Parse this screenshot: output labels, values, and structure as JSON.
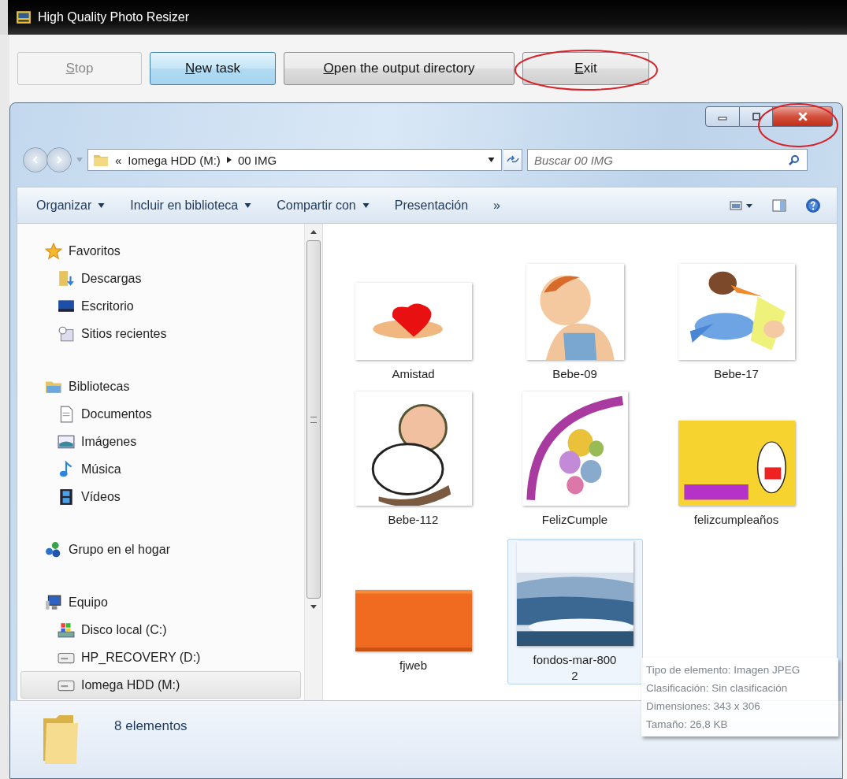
{
  "app_window": {
    "title": "High Quality Photo Resizer"
  },
  "app_buttons": [
    {
      "access": "S",
      "label": "top",
      "disabled": true,
      "default": false
    },
    {
      "access": "N",
      "label": "ew task",
      "disabled": false,
      "default": true
    },
    {
      "access": "O",
      "label": "pen the output directory",
      "disabled": false,
      "default": false
    },
    {
      "access": "E",
      "label": "xit",
      "disabled": false,
      "default": false
    }
  ],
  "explorer": {
    "address": {
      "overflow": "«",
      "crumbs": [
        "Iomega HDD (M:)",
        "00 IMG"
      ]
    },
    "search": {
      "placeholder": "Buscar 00 IMG"
    },
    "commands": [
      {
        "label": "Organizar",
        "dropdown": true
      },
      {
        "label": "Incluir en biblioteca",
        "dropdown": true
      },
      {
        "label": "Compartir con",
        "dropdown": true
      },
      {
        "label": "Presentación",
        "dropdown": false
      },
      {
        "label": "»",
        "dropdown": false
      }
    ],
    "nav": [
      {
        "label": "Favoritos",
        "selected": false,
        "children": [
          {
            "label": "Descargas",
            "selected": false
          },
          {
            "label": "Escritorio",
            "selected": false
          },
          {
            "label": "Sitios recientes",
            "selected": false
          }
        ]
      },
      {
        "label": "Bibliotecas",
        "selected": false,
        "children": [
          {
            "label": "Documentos",
            "selected": false
          },
          {
            "label": "Imágenes",
            "selected": false
          },
          {
            "label": "Música",
            "selected": false
          },
          {
            "label": "Vídeos",
            "selected": false
          }
        ]
      },
      {
        "label": "Grupo en el hogar",
        "selected": false
      },
      {
        "label": "Equipo",
        "selected": false,
        "children": [
          {
            "label": "Disco local (C:)",
            "selected": false
          },
          {
            "label": "HP_RECOVERY (D:)",
            "selected": false
          },
          {
            "label": "Iomega HDD (M:)",
            "selected": true
          }
        ]
      }
    ],
    "files": [
      {
        "label": "Amistad",
        "selected": false
      },
      {
        "label": "Bebe-09",
        "selected": false
      },
      {
        "label": "Bebe-17",
        "selected": false
      },
      {
        "label": "Bebe-112",
        "selected": false
      },
      {
        "label": "FelizCumple",
        "selected": false
      },
      {
        "label": "felizcumpleaños",
        "selected": false
      },
      {
        "label": "fjweb",
        "selected": false
      },
      {
        "label": "fondos-mar-8002",
        "selected": true
      }
    ],
    "tooltip": [
      "Tipo de elemento: Imagen JPEG",
      "Clasificación: Sin clasificación",
      "Dimensiones: 343 x 306",
      "Tamaño: 26,8 KB"
    ],
    "status_bar": {
      "count": "8 elementos"
    }
  }
}
